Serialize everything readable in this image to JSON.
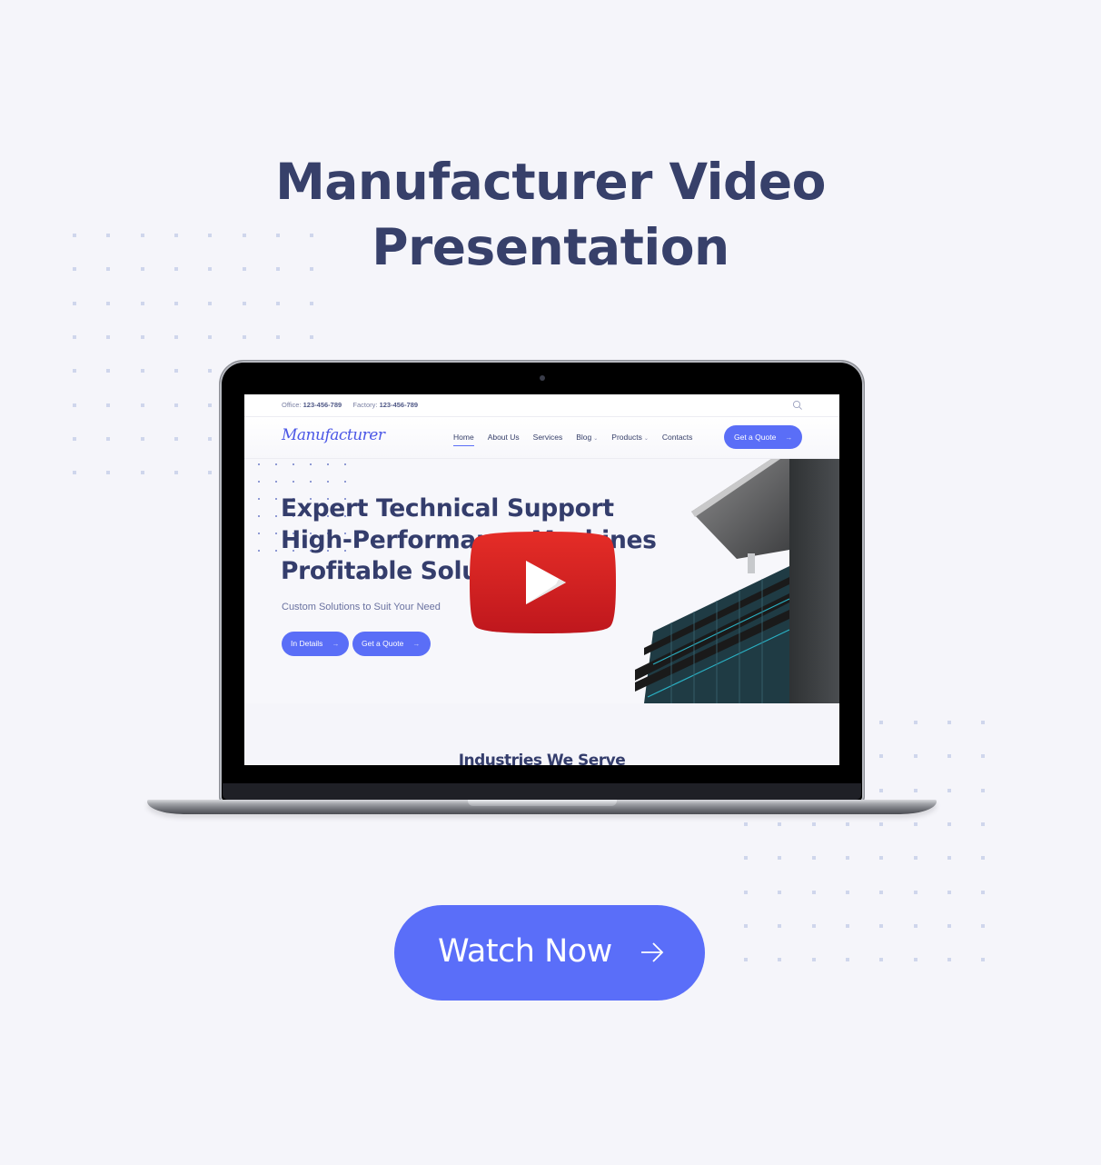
{
  "page": {
    "title_lines": [
      "Manufacturer Video",
      "Presentation"
    ],
    "cta_label": "Watch Now",
    "cta_icon": "arrow-right-icon",
    "colors": {
      "background": "#f5f5fa",
      "title": "#37406a",
      "accent": "#5a6ef9",
      "dots": "#cfd6ec",
      "youtube_red": "#e02a20"
    }
  },
  "device": {
    "type": "laptop",
    "play_icon": "youtube-play-icon"
  },
  "site": {
    "topbar": {
      "office_label": "Office:",
      "office_phone": "123-456-789",
      "factory_label": "Factory:",
      "factory_phone": "123-456-789",
      "search_icon": "search-icon"
    },
    "logo": "Manufacturer",
    "nav": [
      {
        "label": "Home",
        "active": true,
        "dropdown": false
      },
      {
        "label": "About Us",
        "active": false,
        "dropdown": false
      },
      {
        "label": "Services",
        "active": false,
        "dropdown": false
      },
      {
        "label": "Blog",
        "active": false,
        "dropdown": true
      },
      {
        "label": "Products",
        "active": false,
        "dropdown": true
      },
      {
        "label": "Contacts",
        "active": false,
        "dropdown": false
      }
    ],
    "nav_cta": "Get a Quote",
    "hero": {
      "headline": [
        "Expert Technical Support",
        "High-Performance Machines",
        "Profitable Solutions"
      ],
      "subline": "Custom Solutions to Suit Your Need",
      "buttons": [
        "In Details",
        "Get a Quote"
      ]
    },
    "section2_title": "Industries We Serve"
  }
}
